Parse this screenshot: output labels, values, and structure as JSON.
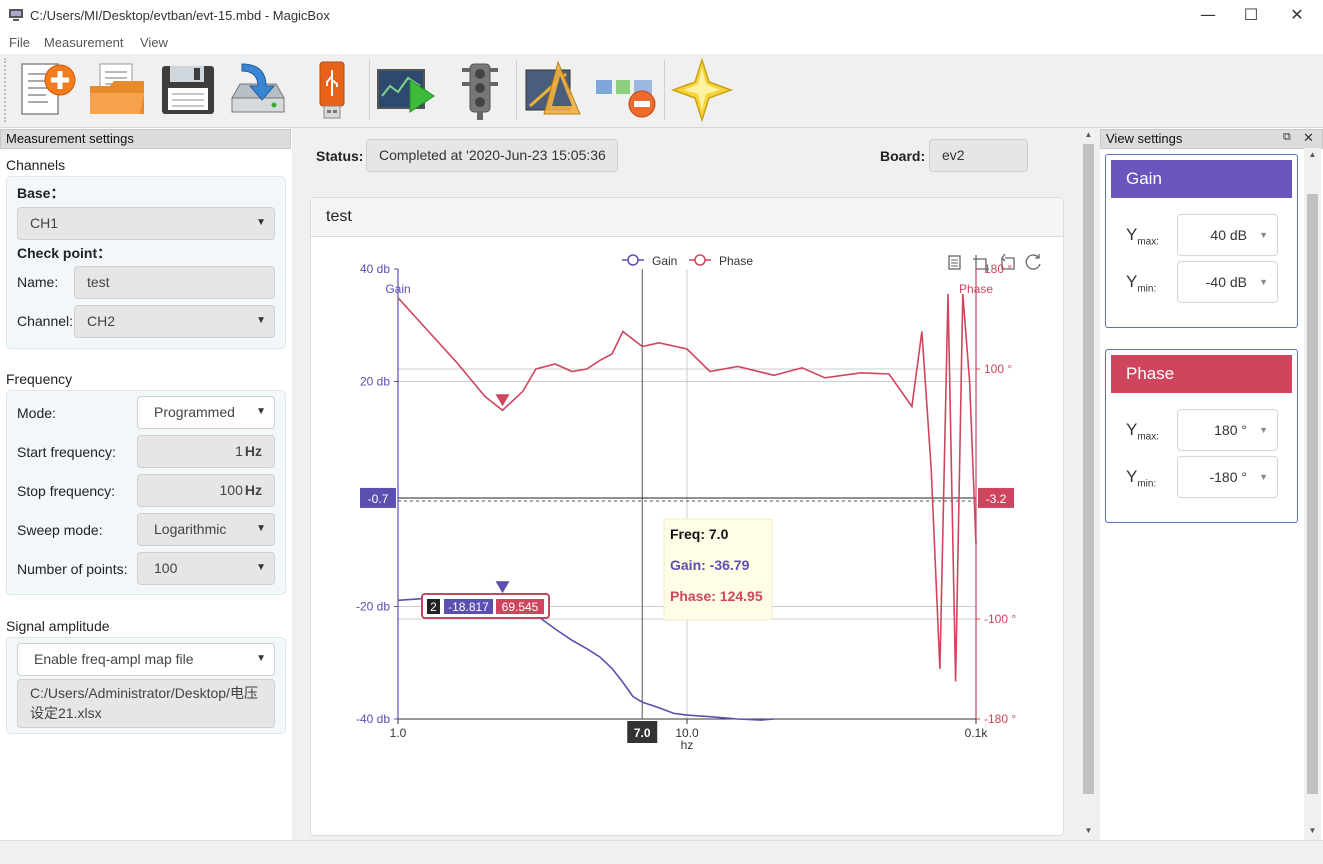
{
  "window": {
    "title": "C:/Users/MI/Desktop/evtban/evt-15.mbd - MagicBox",
    "controls": {
      "minimize": "—",
      "maximize": "☐",
      "close": "✕"
    }
  },
  "menu": [
    "File",
    "Measurement",
    "View"
  ],
  "toolbar": {
    "buttons": [
      "new-document",
      "open-folder",
      "save-floppy",
      "import-disk",
      "usb-stick",
      "run-measurement",
      "traffic-light",
      "geometry-tools",
      "disconnect-board",
      "favorite-star"
    ]
  },
  "left_panel": {
    "header": "Measurement settings",
    "channels": {
      "label": "Channels",
      "base_label": "Base：",
      "base_value": "CH1",
      "check_point_label": "Check point：",
      "name_label": "Name:",
      "name_value": "test",
      "channel_label": "Channel:",
      "channel_value": "CH2"
    },
    "frequency": {
      "label": "Frequency",
      "mode_label": "Mode:",
      "mode_value": "Programmed",
      "start_label": "Start frequency:",
      "start_value": "1",
      "start_unit": "Hz",
      "stop_label": "Stop frequency:",
      "stop_value": "100",
      "stop_unit": "Hz",
      "sweep_label": "Sweep mode:",
      "sweep_value": "Logarithmic",
      "points_label": "Number of points:",
      "points_value": "100"
    },
    "signal": {
      "label": "Signal amplitude",
      "mode_value": "Enable freq-ampl map file",
      "file_line1": "C:/Users/Administrator/Desktop/电压",
      "file_line2": "设定21.xlsx"
    }
  },
  "center": {
    "status_label": "Status:",
    "status_value": "Completed at '2020-Jun-23 15:05:36",
    "board_label": "Board:",
    "board_value": "ev2",
    "card_title": "test"
  },
  "chart_data": {
    "type": "line",
    "x_scale": "log",
    "xlabel": "hz",
    "xlim": [
      1,
      100
    ],
    "x_ticks": [
      "1.0",
      "10.0",
      "0.1k"
    ],
    "left_axis": {
      "label": "Gain",
      "ylim": [
        -40,
        40
      ],
      "ticks": [
        "40 db",
        "20 db",
        "-20 db",
        "-40 db"
      ],
      "color": "#5b4fb0"
    },
    "right_axis": {
      "label": "Phase",
      "ylim": [
        -180,
        180
      ],
      "ticks": [
        "180 °",
        "100 °",
        "-100 °",
        "-180 °"
      ],
      "color": "#d0455e"
    },
    "legend": [
      "Gain",
      "Phase"
    ],
    "legend_position": "top-center",
    "toolbox_icons": [
      "data-view-icon",
      "zoom-icon",
      "zoom-reset-icon",
      "restore-icon"
    ],
    "series": [
      {
        "name": "Gain",
        "axis": "left",
        "color": "#5b4fb0",
        "x": [
          1.0,
          1.3,
          1.6,
          2.0,
          2.5,
          3.0,
          3.5,
          4.0,
          4.5,
          5.0,
          5.5,
          6.0,
          6.5,
          7.0,
          8.0,
          9.0,
          10,
          12,
          15,
          18,
          20
        ],
        "y": [
          -18.9,
          -18.5,
          -18.4,
          -18.7,
          -19.5,
          -21.5,
          -24,
          -26,
          -27.5,
          -29,
          -31,
          -33.5,
          -36,
          -37,
          -38,
          -39,
          -39.3,
          -39.6,
          -40,
          -40.2,
          -40
        ]
      },
      {
        "name": "Phase",
        "axis": "right",
        "color": "#d0455e",
        "x": [
          1.0,
          1.3,
          1.6,
          2.0,
          2.3,
          2.7,
          3.0,
          3.5,
          4.0,
          4.5,
          5.0,
          5.5,
          6.0,
          7.0,
          8.0,
          10,
          12,
          15,
          20,
          25,
          30,
          40,
          50,
          60,
          65,
          70,
          75,
          80,
          85,
          90,
          95,
          100
        ],
        "y": [
          157,
          128,
          105,
          78,
          67,
          82,
          100,
          104,
          98,
          100,
          107,
          112,
          130,
          118,
          121,
          116,
          98,
          102,
          95,
          101,
          93,
          97,
          96,
          70,
          130,
          20,
          -140,
          160,
          -150,
          160,
          90,
          -40
        ]
      }
    ],
    "markers": [
      {
        "series": "Phase",
        "x": 2.3,
        "label": ""
      },
      {
        "series": "Gain",
        "x": 2.3,
        "tooltip": [
          "2",
          "-18.817",
          "69.545"
        ]
      }
    ],
    "crosshair": {
      "x_label": "7.0",
      "left_label": "-0.7",
      "right_label": "-3.2"
    },
    "tooltip": {
      "freq": "Freq: 7.0",
      "gain": "Gain: -36.79",
      "phase": "Phase: 124.95"
    }
  },
  "right_panel": {
    "header": "View settings",
    "gain": {
      "title": "Gain",
      "ymax_label": "Y",
      "ymax_sub": "max:",
      "ymax_value": "40 dB",
      "ymin_label": "Y",
      "ymin_sub": "min:",
      "ymin_value": "-40 dB",
      "color": "#6a56bd"
    },
    "phase": {
      "title": "Phase",
      "ymax_label": "Y",
      "ymax_sub": "max:",
      "ymax_value": "180 °",
      "ymin_label": "Y",
      "ymin_sub": "min:",
      "ymin_value": "-180 °",
      "color": "#d0455e"
    }
  }
}
